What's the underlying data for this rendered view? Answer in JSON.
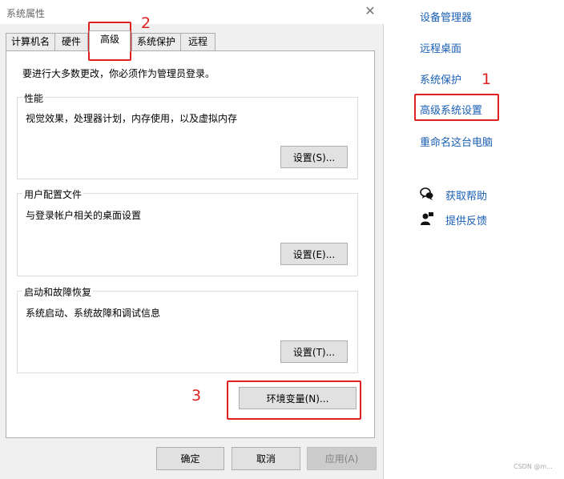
{
  "dialog": {
    "title": "系统属性",
    "close_glyph": "✕",
    "tabs": [
      {
        "label": "计算机名"
      },
      {
        "label": "硬件"
      },
      {
        "label": "高级"
      },
      {
        "label": "系统保护"
      },
      {
        "label": "远程"
      }
    ],
    "active_tab": "高级",
    "notice": "要进行大多数更改，你必须作为管理员登录。",
    "performance": {
      "title": "性能",
      "desc": "视觉效果，处理器计划，内存使用，以及虚拟内存",
      "button": "设置(S)..."
    },
    "profile": {
      "title": "用户配置文件",
      "desc": "与登录帐户相关的桌面设置",
      "button": "设置(E)..."
    },
    "startup": {
      "title": "启动和故障恢复",
      "desc": "系统启动、系统故障和调试信息",
      "button": "设置(T)..."
    },
    "env_button": "环境变量(N)...",
    "ok": "确定",
    "cancel": "取消",
    "apply": "应用(A)"
  },
  "side_links": [
    {
      "label": "设备管理器"
    },
    {
      "label": "远程桌面"
    },
    {
      "label": "系统保护"
    },
    {
      "label": "高级系统设置"
    },
    {
      "label": "重命名这台电脑"
    }
  ],
  "help": {
    "label": "获取帮助",
    "icon": "help-chat-icon"
  },
  "feedback": {
    "label": "提供反馈",
    "icon": "feedback-person-icon"
  },
  "annotations": [
    "1",
    "2",
    "3"
  ],
  "watermark": "CSDN @m...",
  "colors": {
    "link": "#1a5fb4",
    "annotation": "#e02020"
  }
}
